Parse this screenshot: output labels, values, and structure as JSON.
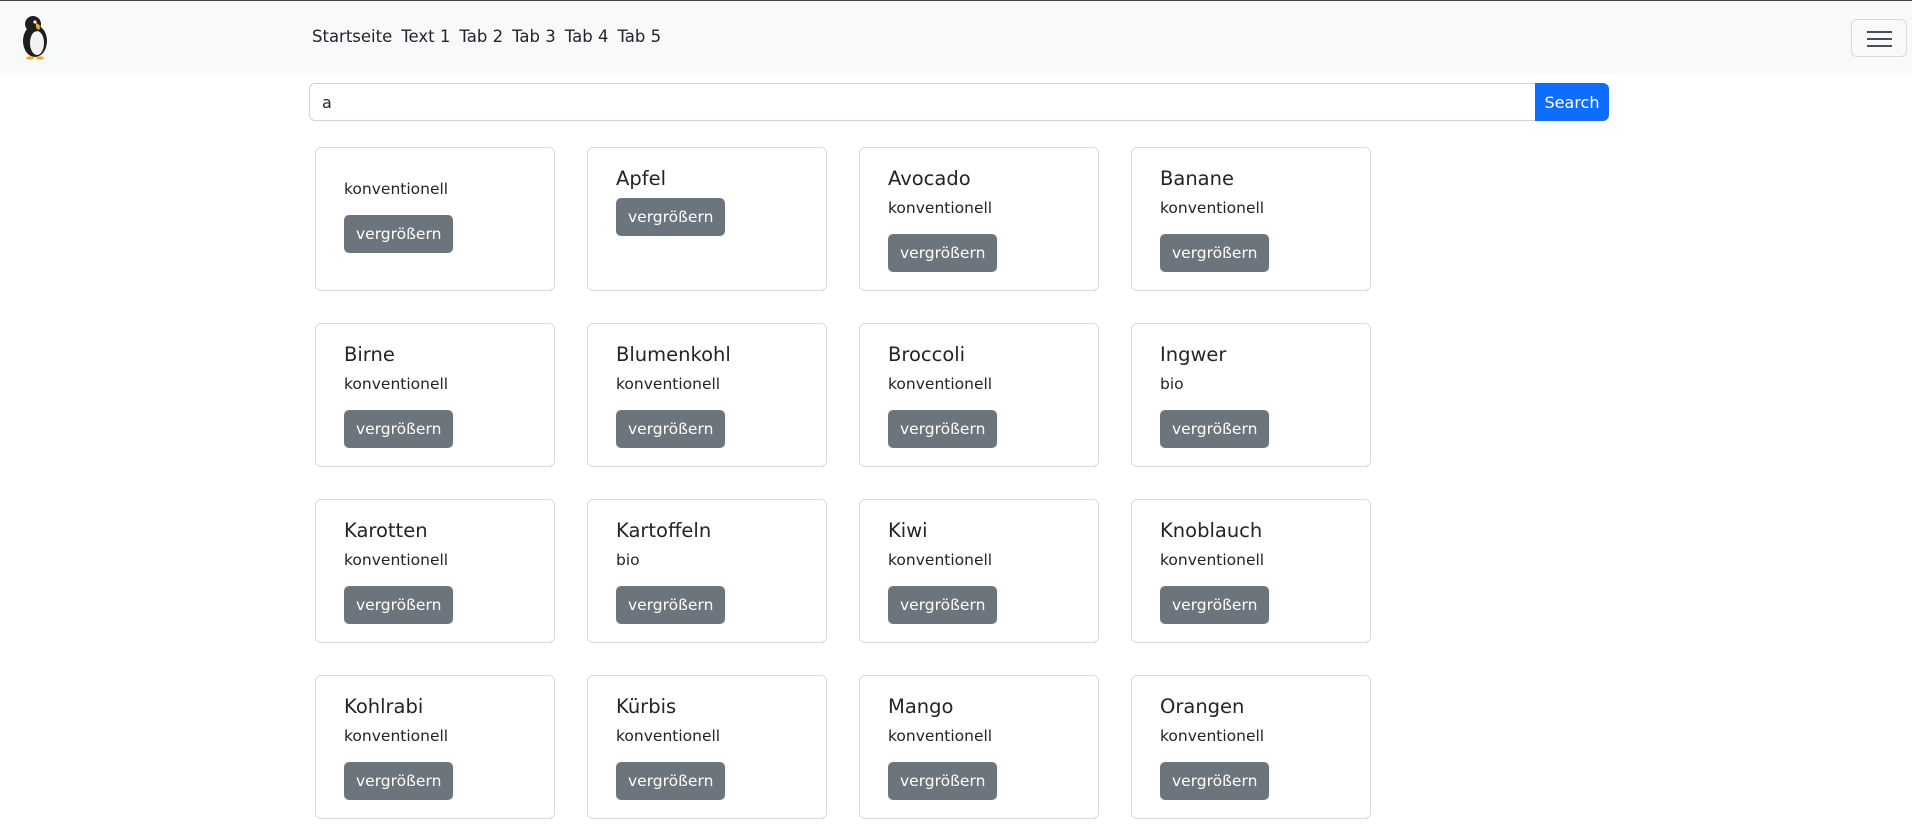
{
  "navbar": {
    "logo_icon": "penguin-icon",
    "links": [
      "Startseite",
      "Text 1",
      "Tab 2",
      "Tab 3",
      "Tab 4",
      "Tab 5"
    ],
    "menu_icon": "hamburger-menu-icon"
  },
  "search": {
    "value": "a",
    "button_label": "Search"
  },
  "colors": {
    "primary": "#0d6efd",
    "secondary": "#6c757d"
  },
  "cards": [
    {
      "title": "",
      "subtitle": "konventionell",
      "button": "vergrößern"
    },
    {
      "title": "Apfel",
      "subtitle": "",
      "button": "vergrößern"
    },
    {
      "title": "Avocado",
      "subtitle": "konventionell",
      "button": "vergrößern"
    },
    {
      "title": "Banane",
      "subtitle": "konventionell",
      "button": "vergrößern"
    },
    {
      "title": "Birne",
      "subtitle": "konventionell",
      "button": "vergrößern"
    },
    {
      "title": "Blumenkohl",
      "subtitle": "konventionell",
      "button": "vergrößern"
    },
    {
      "title": "Broccoli",
      "subtitle": "konventionell",
      "button": "vergrößern"
    },
    {
      "title": "Ingwer",
      "subtitle": "bio",
      "button": "vergrößern"
    },
    {
      "title": "Karotten",
      "subtitle": "konventionell",
      "button": "vergrößern"
    },
    {
      "title": "Kartoffeln",
      "subtitle": "bio",
      "button": "vergrößern"
    },
    {
      "title": "Kiwi",
      "subtitle": "konventionell",
      "button": "vergrößern"
    },
    {
      "title": "Knoblauch",
      "subtitle": "konventionell",
      "button": "vergrößern"
    },
    {
      "title": "Kohlrabi",
      "subtitle": "konventionell",
      "button": "vergrößern"
    },
    {
      "title": "Kürbis",
      "subtitle": "konventionell",
      "button": "vergrößern"
    },
    {
      "title": "Mango",
      "subtitle": "konventionell",
      "button": "vergrößern"
    },
    {
      "title": "Orangen",
      "subtitle": "konventionell",
      "button": "vergrößern"
    }
  ]
}
